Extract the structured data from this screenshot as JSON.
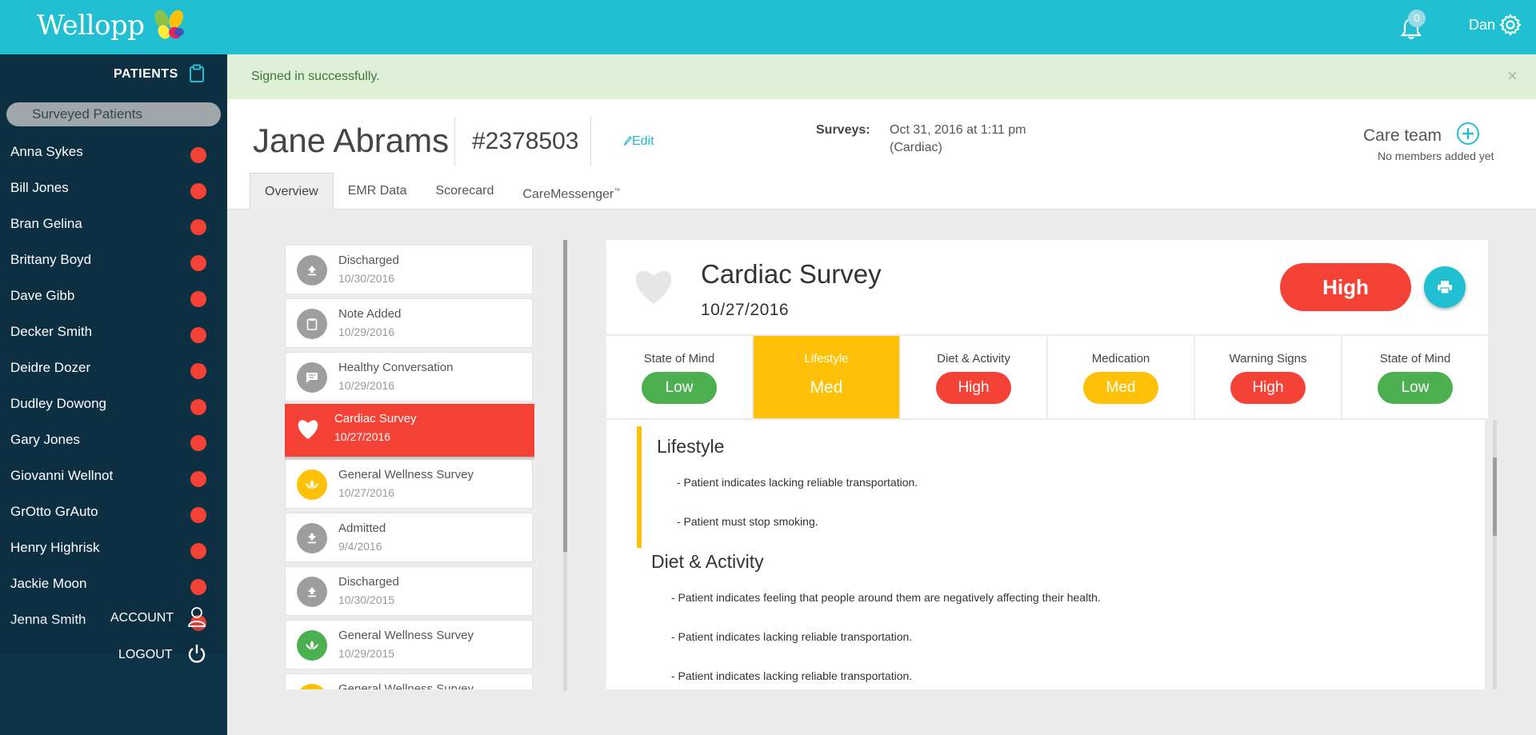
{
  "app": {
    "brand": "Wellopp",
    "notifications_count": "0",
    "user_name": "Dan"
  },
  "sidebar": {
    "title": "PATIENTS",
    "search_placeholder": "Surveyed Patients",
    "patients": [
      {
        "name": "Anna Sykes",
        "status_color": "#f44336"
      },
      {
        "name": "Bill Jones",
        "status_color": "#f44336"
      },
      {
        "name": "Bran Gelina",
        "status_color": "#f44336"
      },
      {
        "name": "Brittany Boyd",
        "status_color": "#f44336"
      },
      {
        "name": "Dave Gibb",
        "status_color": "#f44336"
      },
      {
        "name": "Decker Smith",
        "status_color": "#f44336"
      },
      {
        "name": "Deidre Dozer",
        "status_color": "#f44336"
      },
      {
        "name": "Dudley Dowong",
        "status_color": "#f44336"
      },
      {
        "name": "Gary Jones",
        "status_color": "#f44336"
      },
      {
        "name": "Giovanni Wellnot",
        "status_color": "#f44336"
      },
      {
        "name": "GrOtto GrAuto",
        "status_color": "#f44336"
      },
      {
        "name": "Henry Highrisk",
        "status_color": "#f44336"
      },
      {
        "name": "Jackie Moon",
        "status_color": "#f44336"
      },
      {
        "name": "Jenna Smith",
        "status_color": "#f44336"
      }
    ],
    "account_label": "ACCOUNT",
    "logout_label": "LOGOUT"
  },
  "alert": {
    "message": "Signed in successfully.",
    "close_label": "×"
  },
  "patient": {
    "name": "Jane Abrams",
    "id": "#2378503",
    "edit_label": "Edit",
    "surveys_label": "Surveys:",
    "surveys_date": "Oct 31, 2016 at 1:11 pm",
    "surveys_type": "(Cardiac)",
    "care_team_label": "Care team",
    "care_team_empty": "No members added yet"
  },
  "tabs": [
    {
      "label": "Overview",
      "active": true
    },
    {
      "label": "EMR Data",
      "active": false
    },
    {
      "label": "Scorecard",
      "active": false
    },
    {
      "label": "CareMessenger",
      "sup": "™",
      "active": false
    }
  ],
  "timeline": [
    {
      "title": "Discharged",
      "date": "10/30/2016",
      "icon": "upload-icon",
      "color": "#9e9e9e"
    },
    {
      "title": "Note Added",
      "date": "10/29/2016",
      "icon": "clipboard-icon",
      "color": "#9e9e9e"
    },
    {
      "title": "Healthy Conversation",
      "date": "10/29/2016",
      "icon": "chat-icon",
      "color": "#9e9e9e"
    },
    {
      "title": "Cardiac Survey",
      "date": "10/27/2016",
      "icon": "heart-icon",
      "color": "#f44336",
      "active": true
    },
    {
      "title": "General Wellness Survey",
      "date": "10/27/2016",
      "icon": "lotus-icon",
      "color": "#ffc107"
    },
    {
      "title": "Admitted",
      "date": "9/4/2016",
      "icon": "download-icon",
      "color": "#9e9e9e"
    },
    {
      "title": "Discharged",
      "date": "10/30/2015",
      "icon": "upload-icon",
      "color": "#9e9e9e"
    },
    {
      "title": "General Wellness Survey",
      "date": "10/29/2015",
      "icon": "lotus-icon",
      "color": "#4caf50"
    },
    {
      "title": "General Wellness Survey",
      "date": "",
      "icon": "lotus-icon",
      "color": "#ffc107"
    }
  ],
  "survey": {
    "title": "Cardiac Survey",
    "date": "10/27/2016",
    "risk": "High",
    "risk_color": "#f44336",
    "categories": [
      {
        "label": "State of Mind",
        "level": "Low",
        "color": "#4caf50"
      },
      {
        "label": "Lifestyle",
        "level": "Med",
        "color": "#ffc107",
        "active": true
      },
      {
        "label": "Diet & Activity",
        "level": "High",
        "color": "#f44336"
      },
      {
        "label": "Medication",
        "level": "Med",
        "color": "#ffc107"
      },
      {
        "label": "Warning Signs",
        "level": "High",
        "color": "#f44336"
      },
      {
        "label": "State of Mind",
        "level": "Low",
        "color": "#4caf50"
      }
    ],
    "sections": [
      {
        "title": "Lifestyle",
        "items": [
          "- Patient indicates lacking reliable transportation.",
          "- Patient must stop smoking."
        ]
      },
      {
        "title": "Diet & Activity",
        "items": [
          "- Patient indicates feeling that people around them are negatively affecting their health.",
          "- Patient indicates lacking reliable transportation.",
          "- Patient indicates lacking reliable transportation."
        ]
      }
    ]
  }
}
